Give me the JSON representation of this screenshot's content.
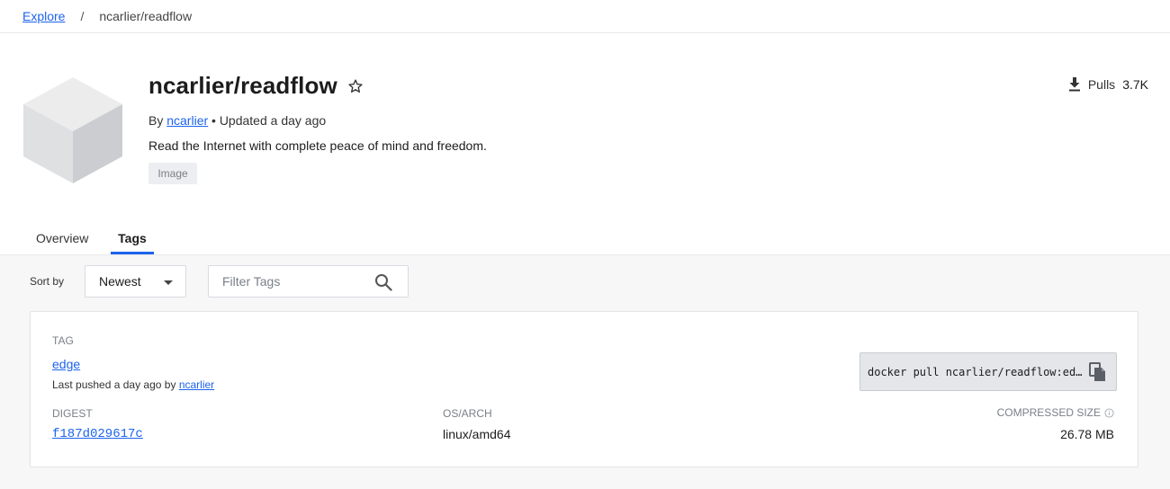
{
  "breadcrumb": {
    "explore_label": "Explore",
    "separator": "/",
    "current": "ncarlier/readflow"
  },
  "repo": {
    "title": "ncarlier/readflow",
    "by_label": "By",
    "author": "ncarlier",
    "updated": "• Updated a day ago",
    "description": "Read the Internet with complete peace of mind and freedom.",
    "badge": "Image"
  },
  "pulls": {
    "label": "Pulls",
    "count": "3.7K"
  },
  "tabs": [
    {
      "label": "Overview",
      "active": false
    },
    {
      "label": "Tags",
      "active": true
    }
  ],
  "toolbar": {
    "sort_label": "Sort by",
    "sort_value": "Newest",
    "filter_placeholder": "Filter Tags"
  },
  "tag_card": {
    "tag_heading": "TAG",
    "tag_name": "edge",
    "pushed_prefix": "Last pushed",
    "pushed_when": "a day ago",
    "pushed_by_label": "by",
    "pushed_by": "ncarlier",
    "pull_command": "docker pull ncarlier/readflow:edge",
    "digest_heading": "DIGEST",
    "digest_value": "f187d029617c",
    "osarch_heading": "OS/ARCH",
    "osarch_value": "linux/amd64",
    "size_heading": "COMPRESSED SIZE",
    "size_value": "26.78 MB"
  },
  "colors": {
    "accent": "#1d63ed",
    "gray_background": "#f7f7f8"
  },
  "icons": [
    "star-icon",
    "download-icon",
    "search-icon",
    "copy-icon",
    "info-icon",
    "cube-icon",
    "chevron-down-icon"
  ]
}
